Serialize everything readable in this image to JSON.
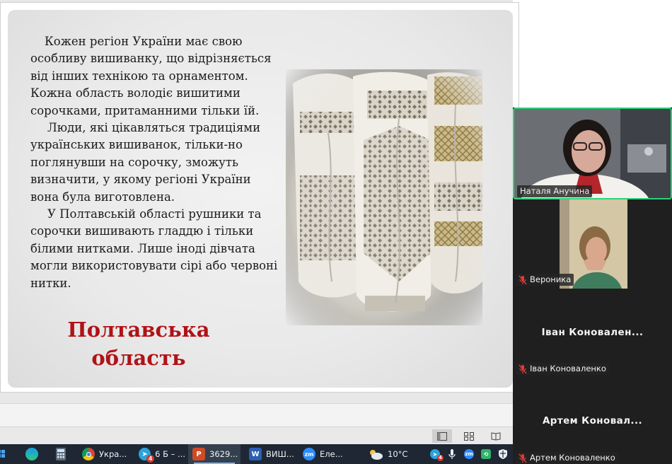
{
  "slide": {
    "paragraphs": [
      "Кожен регіон України має свою особливу вишиванку, що відрізняється від інших технікою та орнаментом. Кожна область володіє вишитими сорочками, притаманними тільки їй.",
      "Люди, які цікавляться традиціями українських вишиванок, тільки-но поглянувши на сорочку, зможуть визначити, у якому регіоні України вона була виготовлена.",
      "У Полтавській області рушники та сорочки вишивають гладдю і тільки білими нитками. Лише іноді дівчата могли використовувати сірі або червоні нитки."
    ],
    "title_line1": "Полтавська",
    "title_line2": "область",
    "title_color": "#b01217"
  },
  "zoom": {
    "participants": [
      {
        "name": "Наталя Анучина",
        "video": true,
        "muted": false,
        "active_speaker": true
      },
      {
        "name": "Вероника",
        "video": true,
        "muted": true
      },
      {
        "name": "Іван Коноваленко",
        "display": "Іван  Коновален...",
        "video": false,
        "muted": true
      },
      {
        "name": "Артем Коноваленко",
        "display": "Артем  Коновал...",
        "video": false,
        "muted": true
      }
    ],
    "active_color": "#2bd37a"
  },
  "taskbar": {
    "items": [
      {
        "label": "Укра...",
        "icon": "chrome-icon"
      },
      {
        "label": "6 Б – ...",
        "icon": "telegram-icon",
        "badge": "4"
      },
      {
        "label": "3629...",
        "icon": "powerpoint-icon"
      },
      {
        "label": "ВИШ...",
        "icon": "word-icon"
      },
      {
        "label": "Еле...",
        "icon": "zoom-icon"
      }
    ],
    "weather": "10°C",
    "tray_badge": "4"
  }
}
